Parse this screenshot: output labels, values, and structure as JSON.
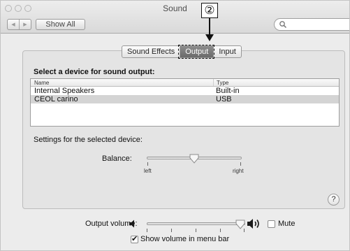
{
  "window": {
    "title": "Sound",
    "show_all_label": "Show All",
    "nav_back_icon": "back-arrow-icon",
    "nav_forward_icon": "forward-arrow-icon",
    "search": {
      "value": "",
      "icon": "search-icon"
    }
  },
  "annotation": {
    "callout_label": "2"
  },
  "tabs": [
    {
      "label": "Sound Effects",
      "selected": false
    },
    {
      "label": "Output",
      "selected": true
    },
    {
      "label": "Input",
      "selected": false
    }
  ],
  "output": {
    "select_heading": "Select a device for sound output:",
    "table": {
      "columns": [
        "Name",
        "Type"
      ],
      "rows": [
        {
          "name": "Internal Speakers",
          "type": "Built-in",
          "selected": false
        },
        {
          "name": "CEOL carino",
          "type": "USB",
          "selected": true
        }
      ]
    },
    "settings_label": "Settings for the selected device:",
    "balance": {
      "label": "Balance:",
      "left_label": "left",
      "right_label": "right",
      "value": 0.5
    }
  },
  "help_label": "?",
  "footer": {
    "output_volume_label": "Output volume:",
    "volume_level": 0.95,
    "low_volume_icon": "speaker-low-icon",
    "high_volume_icon": "speaker-high-icon",
    "mute_label": "Mute",
    "mute_checked": false,
    "show_volume_label": "Show volume in menu bar",
    "show_volume_checked": true
  }
}
